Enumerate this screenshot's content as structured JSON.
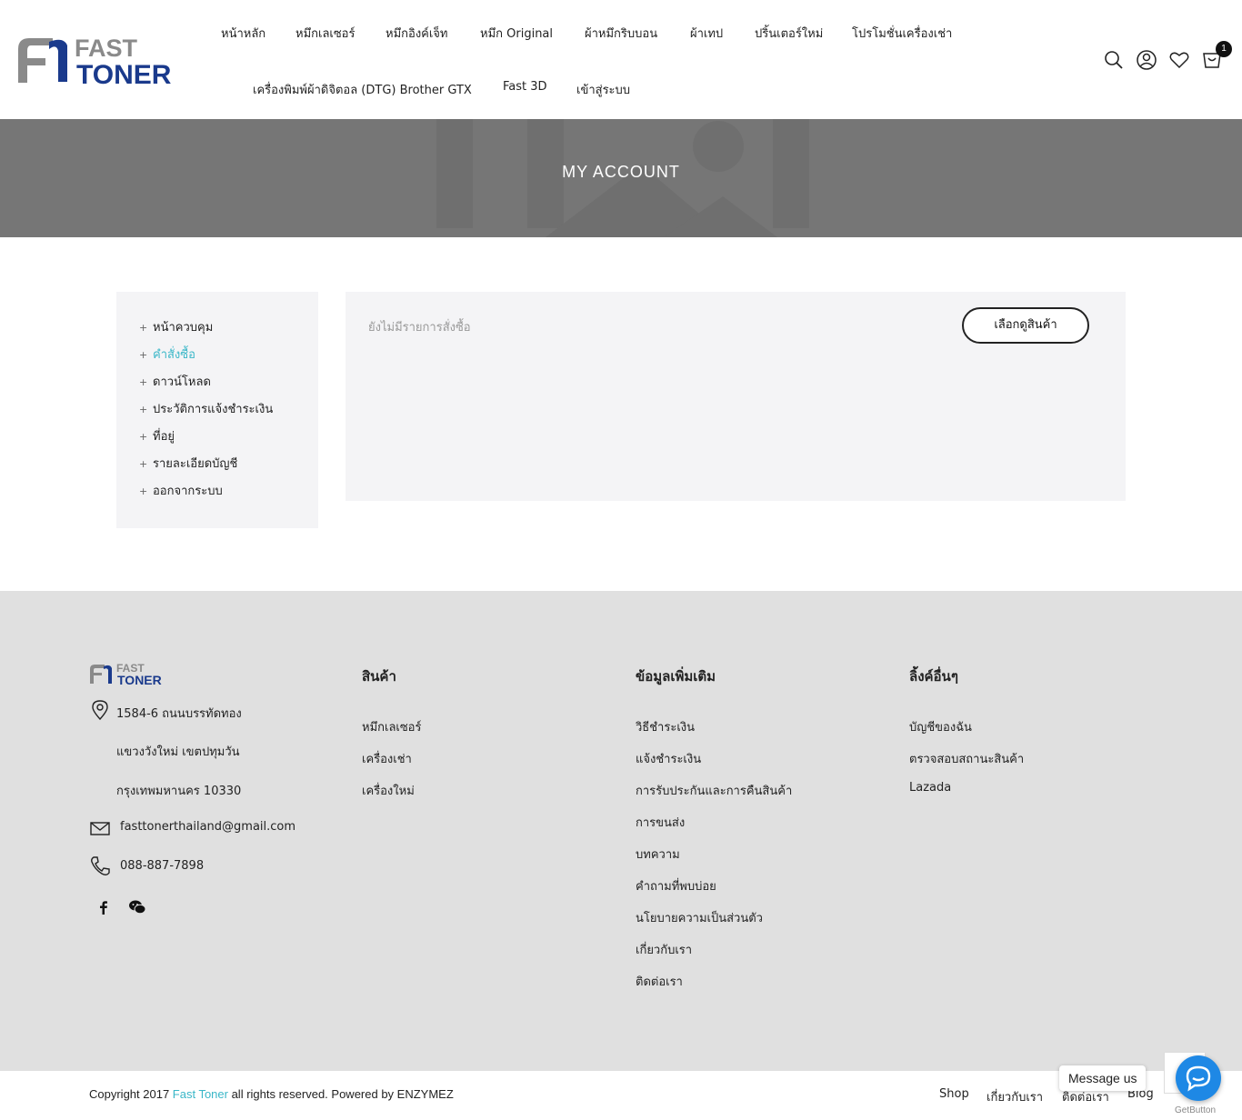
{
  "header": {
    "logo_text_top": "FAST",
    "logo_text_bottom": "TONER",
    "nav": [
      {
        "label": "หน้าหลัก"
      },
      {
        "label": "หมึกเลเซอร์"
      },
      {
        "label": "หมึกอิงค์เจ็ท"
      },
      {
        "label": "หมึก Original"
      },
      {
        "label": "ผ้าหมึกริบบอน"
      },
      {
        "label": "ผ้าเทป"
      },
      {
        "label": "ปริ้นเตอร์ใหม่"
      },
      {
        "label": "โปรโมชั่นเครื่องเช่า"
      },
      {
        "label": "เครื่องพิมพ์ผ้าดิจิตอล (DTG) Brother GTX"
      },
      {
        "label": "Fast 3D"
      },
      {
        "label": "เข้าสู่ระบบ"
      }
    ],
    "icons": [
      "search-icon",
      "user-icon",
      "heart-icon",
      "cart-icon"
    ],
    "cart_count": "1"
  },
  "banner": {
    "title": "MY ACCOUNT"
  },
  "account": {
    "nav": [
      {
        "label": "หน้าควบคุม",
        "active": false
      },
      {
        "label": "คำสั่งซื้อ",
        "active": true
      },
      {
        "label": "ดาวน์โหลด",
        "active": false
      },
      {
        "label": "ประวัติการแจ้งชำระเงิน",
        "active": false
      },
      {
        "label": "ที่อยู่",
        "active": false
      },
      {
        "label": "รายละเอียดบัญชี",
        "active": false
      },
      {
        "label": "ออกจากระบบ",
        "active": false
      }
    ],
    "empty_message": "ยังไม่มีรายการสั่งซื้อ",
    "shop_button": "เลือกดูสินค้า"
  },
  "footer": {
    "logo_text_top": "FAST",
    "logo_text_bottom": "TONER",
    "address_line1": "1584-6 ถนนบรรทัดทอง",
    "address_line2": "แขวงวังใหม่ เขตปทุมวัน",
    "address_line3": "กรุงเทพมหานคร 10330",
    "email": "fasttonerthailand@gmail.com",
    "phone": "088-887-7898",
    "columns": [
      {
        "heading": "สินค้า",
        "links": [
          "หมึกเลเซอร์",
          "เครื่องเช่า",
          "เครื่องใหม่"
        ]
      },
      {
        "heading": "ข้อมูลเพิ่มเติม",
        "links": [
          "วิธีชำระเงิน",
          "แจ้งชำระเงิน",
          "การรับประกันและการคืนสินค้า",
          "การขนส่ง",
          "บทความ",
          "คำถามที่พบบ่อย",
          "นโยบายความเป็นส่วนตัว",
          "เกี่ยวกับเรา",
          "ติดต่อเรา"
        ]
      },
      {
        "heading": "ลิ้งค์อื่นๆ",
        "links": [
          "บัญชีของฉัน",
          "ตรวจสอบสถานะสินค้า",
          "Lazada"
        ]
      }
    ]
  },
  "bottom": {
    "copyright_prefix": "Copyright 2017 ",
    "brand": "Fast Toner",
    "copyright_suffix": " all rights reserved. Powered by ENZYMEZ",
    "links": [
      "Shop",
      "เกี่ยวกับเรา",
      "ติดต่อเรา",
      "Blog"
    ]
  },
  "widget": {
    "message_label": "Message us",
    "credit": "GetButton"
  },
  "colors": {
    "accent": "#3ab7c8",
    "logo_gray": "#8a8a8a",
    "logo_blue": "#1a3a8c",
    "banner_bg": "#767676",
    "footer_bg": "#e0e0e0",
    "messenger_blue": "#1e88e5"
  }
}
